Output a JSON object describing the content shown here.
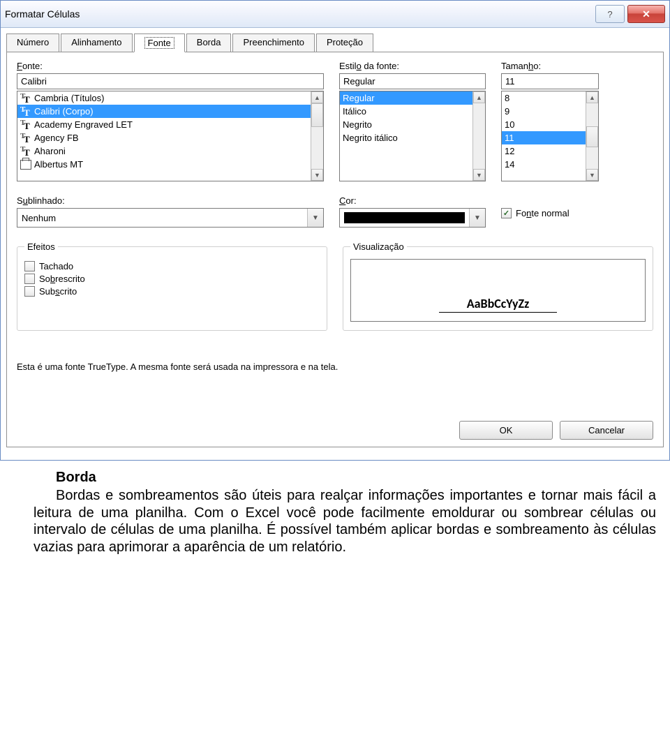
{
  "titlebar": {
    "title": "Formatar Células"
  },
  "tabs": [
    "Número",
    "Alinhamento",
    "Fonte",
    "Borda",
    "Preenchimento",
    "Proteção"
  ],
  "active_tab": 2,
  "font_section": {
    "label_html": "<u class='acc'>F</u>onte:",
    "value": "Calibri",
    "items": [
      {
        "text": "Cambria (Títulos)",
        "icon": "tt"
      },
      {
        "text": "Calibri (Corpo)",
        "icon": "tt",
        "selected": true
      },
      {
        "text": "Academy Engraved LET",
        "icon": "tt"
      },
      {
        "text": "Agency FB",
        "icon": "tt"
      },
      {
        "text": "Aharoni",
        "icon": "tt"
      },
      {
        "text": "Albertus MT",
        "icon": "printer"
      }
    ]
  },
  "style_section": {
    "label_html": "Estil<u class='acc'>o</u> da fonte:",
    "value": "Regular",
    "items": [
      {
        "text": "Regular",
        "selected": true
      },
      {
        "text": "Itálico"
      },
      {
        "text": "Negrito"
      },
      {
        "text": "Negrito itálico"
      }
    ]
  },
  "size_section": {
    "label_html": "Taman<u class='acc'>h</u>o:",
    "value": "11",
    "items": [
      {
        "text": "8"
      },
      {
        "text": "9"
      },
      {
        "text": "10"
      },
      {
        "text": "11",
        "selected": true
      },
      {
        "text": "12"
      },
      {
        "text": "14"
      }
    ]
  },
  "underline": {
    "label_html": "S<u class='acc'>u</u>blinhado:",
    "value": "Nenhum"
  },
  "color": {
    "label_html": "<u class='acc'>C</u>or:",
    "value": "#000000"
  },
  "normal_font": {
    "label_html": "Fo<u class='acc'>n</u>te normal",
    "checked": true
  },
  "effects": {
    "legend": "Efeitos",
    "items": [
      {
        "label_html": "Tachado",
        "checked": false
      },
      {
        "label_html": "So<u class='acc'>b</u>rescrito",
        "checked": false
      },
      {
        "label_html": "Sub<u class='acc'>s</u>crito",
        "checked": false
      }
    ]
  },
  "preview": {
    "legend": "Visualização",
    "sample": "AaBbCcYyZz"
  },
  "hint": "Esta é uma fonte TrueType. A mesma fonte será usada na impressora e na tela.",
  "buttons": {
    "ok": "OK",
    "cancel": "Cancelar"
  },
  "doc": {
    "heading": "Borda",
    "body": "Bordas e sombreamentos são úteis para realçar informações importantes e tornar mais fácil a leitura de uma planilha. Com o Excel você pode facilmente emoldurar ou sombrear células ou intervalo de células de uma planilha. É possível também aplicar bordas e sombreamento às células vazias para aprimorar a aparência de um relatório."
  }
}
